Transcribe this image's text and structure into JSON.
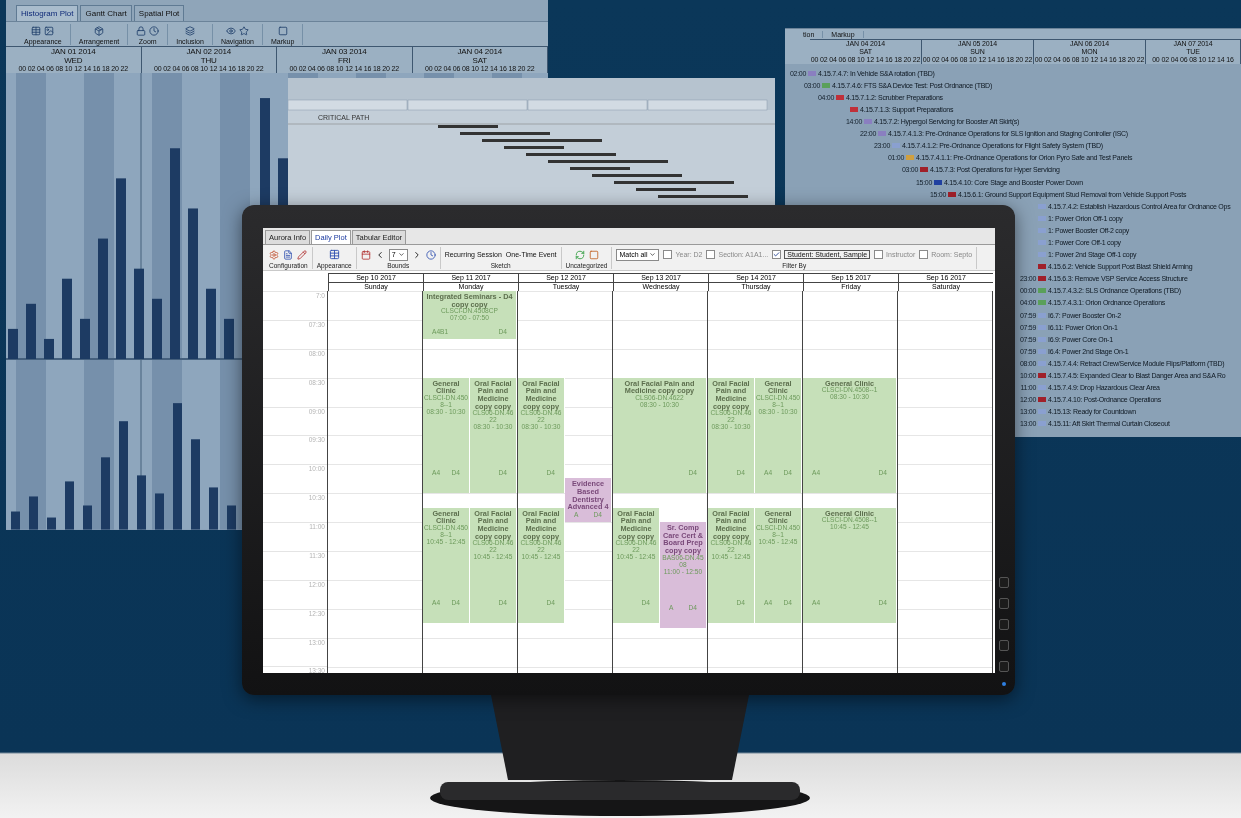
{
  "histogram_window": {
    "tabs": [
      {
        "label": "Histogram Plot",
        "selected": true
      },
      {
        "label": "Gantt Chart",
        "selected": false
      },
      {
        "label": "Spatial Plot",
        "selected": false
      }
    ],
    "toolbar_groups": [
      "Appearance",
      "Arrangement",
      "Zoom",
      "Inclusion",
      "Navigation",
      "Markup"
    ],
    "days": [
      {
        "date": "JAN 01 2014",
        "weekday": "WED",
        "hours": "00 02 04 06 08 10 12 14 16 18 20 22"
      },
      {
        "date": "JAN 02 2014",
        "weekday": "THU",
        "hours": "00 02 04 06 08 10 12 14 16 18 20 22"
      },
      {
        "date": "JAN 03 2014",
        "weekday": "FRI",
        "hours": "00 02 04 06 08 10 12 14 16 18 20 22"
      },
      {
        "date": "JAN 04 2014",
        "weekday": "SAT",
        "hours": "00 02 04 06 08 10 12 14 16 18 20 22"
      }
    ]
  },
  "critical_path_window": {
    "label": "CRITICAL PATH"
  },
  "gantt_window": {
    "toolbar_groups": [
      "tion",
      "Markup"
    ],
    "days": [
      {
        "date": "JAN 04 2014",
        "weekday": "SAT",
        "hours": "00 02 04 06 08 10 12 14 16 18 20 22"
      },
      {
        "date": "JAN 05 2014",
        "weekday": "SUN",
        "hours": "00 02 04 06 08 10 12 14 16 18 20 22"
      },
      {
        "date": "JAN 06 2014",
        "weekday": "MON",
        "hours": "00 02 04 06 08 10 12 14 16 18 20 22"
      },
      {
        "date": "JAN 07 2014",
        "weekday": "TUE",
        "hours": "00 02 04 06 08 10 12 14 16"
      }
    ],
    "tasks": [
      {
        "time": "02:00",
        "label": "4.15.7.4.7: In Vehicle S&A rotation (TBD)",
        "color": "#8a7fc0"
      },
      {
        "time": "03:00",
        "label": "4.15.7.4.6: FTS S&A Device Test: Post Ordnance (TBD)",
        "color": "#5aa05a"
      },
      {
        "time": "04:00",
        "label": "4.15.7.1.2: Scrubber Preparations",
        "color": "#c0303a"
      },
      {
        "label": "4.15.7.1.3: Support Preparations",
        "color": "#c0303a"
      },
      {
        "time": "14:00",
        "label": "4.15.7.2: Hypergol Servicing for Booster Aft Skirt(s)",
        "color": "#8a7fc0"
      },
      {
        "time": "22:00",
        "label": "4.15.7.4.1.3: Pre-Ordnance Operations for SLS Ignition and Staging Controller (ISC)",
        "color": "#8a7fc0"
      },
      {
        "time": "23:00",
        "label": "4.15.7.4.1.2: Pre-Ordnance Operations for Flight Safety System (TBD)",
        "color": "#8aa0d0"
      },
      {
        "time": "01:00",
        "label": "4.15.7.4.1.1: Pre-Ordnance Operations for Orion Pyro Safe and Test Panels",
        "color": "#d0a040"
      },
      {
        "time": "03:00",
        "label": "4.15.7.3: Post Operations for Hyper Servicing",
        "color": "#a0202a"
      },
      {
        "time": "15:00",
        "label": "4.15.4.10: Core Stage and Booster Power Down",
        "color": "#2040a0"
      },
      {
        "time": "15:00",
        "label": "4.15.6.1: Ground Support Equipment Stud Removal from Vehicle Support Posts",
        "color": "#a0202a"
      },
      {
        "label": "4.15.7.4.2: Establish Hazardous Control Area for Ordnance Ops",
        "color": "#8aa0d0"
      },
      {
        "label": "1: Power Orion Off-1 copy",
        "color": "#8aa0d0"
      },
      {
        "label": "1: Power Booster Off-2 copy",
        "color": "#8aa0d0"
      },
      {
        "label": "1: Power Core Off-1 copy",
        "color": "#8aa0d0"
      },
      {
        "label": "1: Power 2nd Stage Off-1 copy",
        "color": "#8aa0d0"
      },
      {
        "label": "4.15.6.2: Vehicle Support Post Blast Shield Arming",
        "color": "#a0202a"
      },
      {
        "time": "23:00",
        "label": "4.15.6.3: Remove VSP Service Access Structure",
        "color": "#a0202a"
      },
      {
        "time": "00:00",
        "label": "4.15.7.4.3.2: SLS Ordnance Operations (TBD)",
        "color": "#5aa05a"
      },
      {
        "time": "04:00",
        "label": "4.15.7.4.3.1: Orion Ordnance Operations",
        "color": "#5aa05a"
      },
      {
        "time": "07:59",
        "label": "I6.7: Power Booster On-2",
        "color": "#8aa0d0"
      },
      {
        "time": "07:59",
        "label": "I6.11: Power Orion On-1",
        "color": "#8aa0d0"
      },
      {
        "time": "07:59",
        "label": "I6.9: Power Core On-1",
        "color": "#8aa0d0"
      },
      {
        "time": "07:59",
        "label": "I6.4: Power 2nd Stage On-1",
        "color": "#8aa0d0"
      },
      {
        "time": "08:00",
        "label": "4.15.7.4.4: Retract Crew/Service Module Flips/Platform (TBD)",
        "color": "#8aa0d0"
      },
      {
        "time": "10:00",
        "label": "4.15.7.4.5: Expanded Clear to Blast Danger Area and S&A Ro",
        "color": "#a0202a"
      },
      {
        "time": "11:00",
        "label": "4.15.7.4.9: Drop Hazardous Clear Area",
        "color": "#8aa0d0"
      },
      {
        "time": "12:00",
        "label": "4.15.7.4.10: Post-Ordnance Operations",
        "color": "#a0202a"
      },
      {
        "time": "13:00",
        "label": "4.15.13: Ready for Countdown",
        "color": "#8aa0d0"
      },
      {
        "time": "13:00",
        "label": "4.15.11: Aft Skirt Thermal Curtain Closeout",
        "color": "#8aa0d0"
      }
    ]
  },
  "monitor": {
    "tabs": [
      {
        "label": "Aurora Info",
        "selected": false
      },
      {
        "label": "Daily Plot",
        "selected": true
      },
      {
        "label": "Tabular Editor",
        "selected": false
      }
    ],
    "toolbar_groups": [
      {
        "kind": "configuration",
        "label": "Configuration"
      },
      {
        "kind": "appearance",
        "label": "Appearance"
      },
      {
        "kind": "bounds",
        "label": "Bounds",
        "select": "7"
      },
      {
        "kind": "sketch",
        "label": "Sketch",
        "buttons": [
          "Recurring Session",
          "One-Time Event"
        ]
      },
      {
        "kind": "uncategorized",
        "label": "Uncategorized"
      },
      {
        "kind": "filter",
        "label": "Filter By",
        "match": "Match all",
        "filters": [
          {
            "label": "Year: D2",
            "checked": false
          },
          {
            "label": "Section: A1A1...",
            "checked": false
          },
          {
            "label": "Student: Student, Sample",
            "checked": true
          },
          {
            "label": "Instructor",
            "checked": false
          },
          {
            "label": "Room: Septo",
            "checked": false
          }
        ]
      }
    ],
    "times": [
      "7:0",
      "07:30",
      "08:00",
      "08:30",
      "09:00",
      "09:30",
      "10:00",
      "10:30",
      "11:00",
      "11:30",
      "12:00",
      "12:30",
      "13:00",
      "13:30"
    ],
    "days": [
      {
        "date": "Sep 10 2017",
        "weekday": "Sunday"
      },
      {
        "date": "Sep 11 2017",
        "weekday": "Monday",
        "groups": [
          {
            "columns": [
              {
                "events": [
                  {
                    "title": "Integrated Seminars - D4 copy copy",
                    "code": "CLSCI-DN.4508CP",
                    "time": "07:00 - 07:50",
                    "footer_left": "A4B1",
                    "footer_right": "D4",
                    "color": "#c6e0b9"
                  }
                ]
              }
            ]
          },
          {
            "columns": [
              {
                "events": [
                  {
                    "title": "General Clinic",
                    "code": "CLSCI-DN.4508--1",
                    "time": "08:30 - 10:30",
                    "footer_left": "A4",
                    "footer_right": "D4",
                    "color": "#c6e0b9"
                  },
                  {
                    "title": "General Clinic",
                    "code": "CLSCI-DN.4508--1",
                    "time": "10:45 - 12:45",
                    "footer_left": "A4",
                    "footer_right": "D4",
                    "color": "#c6e0b9"
                  }
                ]
              },
              {
                "events": [
                  {
                    "title": "Oral Facial Pain and Medicine copy copy",
                    "code": "CLS06-DN.4622",
                    "time": "08:30 - 10:30",
                    "footer_right": "D4",
                    "color": "#c6e0b9"
                  },
                  {
                    "title": "Oral Facial Pain and Medicine copy copy",
                    "code": "CLS06-DN.4622",
                    "time": "10:45 - 12:45",
                    "footer_right": "D4",
                    "color": "#c6e0b9"
                  }
                ]
              }
            ]
          }
        ]
      },
      {
        "date": "Sep 12 2017",
        "weekday": "Tuesday",
        "groups": [
          {
            "columns": [
              {
                "events": [
                  {
                    "title": "Oral Facial Pain and Medicine copy copy",
                    "code": "CLS06-DN.4622",
                    "time": "08:30 - 10:30",
                    "footer_right": "D4",
                    "color": "#c6e0b9"
                  },
                  {
                    "title": "Oral Facial Pain and Medicine copy copy",
                    "code": "CLS06-DN.4622",
                    "time": "10:45 - 12:45",
                    "footer_right": "D4",
                    "color": "#c6e0b9"
                  }
                ]
              },
              {
                "events": [
                  {
                    "title": "Evidence Based Dentistry Advanced 4",
                    "footer_left": "A",
                    "footer_right": "D4",
                    "color": "#d9bdd9"
                  }
                ]
              }
            ]
          }
        ]
      },
      {
        "date": "Sep 13 2017",
        "weekday": "Wednesday",
        "groups": [
          {
            "columns": [
              {
                "events": [
                  {
                    "title": "Oral Facial Pain and Medicine copy copy",
                    "code": "CLS06-DN.4622",
                    "time": "08:30 - 10:30",
                    "footer_right": "D4",
                    "color": "#c6e0b9"
                  }
                ]
              }
            ]
          },
          {
            "columns": [
              {
                "events": [
                  {
                    "title": "Oral Facial Pain and Medicine copy copy",
                    "code": "CLS06-DN.4622",
                    "time": "10:45 - 12:45",
                    "footer_right": "D4",
                    "color": "#c6e0b9"
                  }
                ]
              },
              {
                "events": [
                  {
                    "title": "Sr. Comp Care Cert & Board Prep copy copy",
                    "code": "BAS06-DN.4508",
                    "time": "11:00 - 12:50",
                    "footer_left": "A",
                    "footer_right": "D4",
                    "color": "#d9bdd9"
                  }
                ]
              }
            ]
          }
        ]
      },
      {
        "date": "Sep 14 2017",
        "weekday": "Thursday",
        "groups": [
          {
            "columns": [
              {
                "events": [
                  {
                    "title": "Oral Facial Pain and Medicine copy copy",
                    "code": "CLS06-DN.4622",
                    "time": "08:30 - 10:30",
                    "footer_right": "D4",
                    "color": "#c6e0b9"
                  },
                  {
                    "title": "Oral Facial Pain and Medicine copy copy",
                    "code": "CLS06-DN.4622",
                    "time": "10:45 - 12:45",
                    "footer_right": "D4",
                    "color": "#c6e0b9"
                  }
                ]
              },
              {
                "events": [
                  {
                    "title": "General Clinic",
                    "code": "CLSCI-DN.4508--1",
                    "time": "08:30 - 10:30",
                    "footer_left": "A4",
                    "footer_right": "D4",
                    "color": "#c6e0b9"
                  },
                  {
                    "title": "General Clinic",
                    "code": "CLSCI-DN.4508--1",
                    "time": "10:45 - 12:45",
                    "footer_left": "A4",
                    "footer_right": "D4",
                    "color": "#c6e0b9"
                  }
                ]
              }
            ]
          }
        ]
      },
      {
        "date": "Sep 15 2017",
        "weekday": "Friday",
        "groups": [
          {
            "columns": [
              {
                "events": [
                  {
                    "title": "General Clinic",
                    "code": "CLSCI-DN.4508--1",
                    "time": "08:30 - 10:30",
                    "footer_left": "A4",
                    "footer_right": "D4",
                    "color": "#c6e0b9"
                  },
                  {
                    "title": "General Clinic",
                    "code": "CLSCI-DN.4508--1",
                    "time": "10:45 - 12:45",
                    "footer_left": "A4",
                    "footer_right": "D4",
                    "color": "#c6e0b9"
                  }
                ]
              }
            ]
          }
        ]
      },
      {
        "date": "Sep 16 2017",
        "weekday": "Saturday"
      }
    ]
  }
}
